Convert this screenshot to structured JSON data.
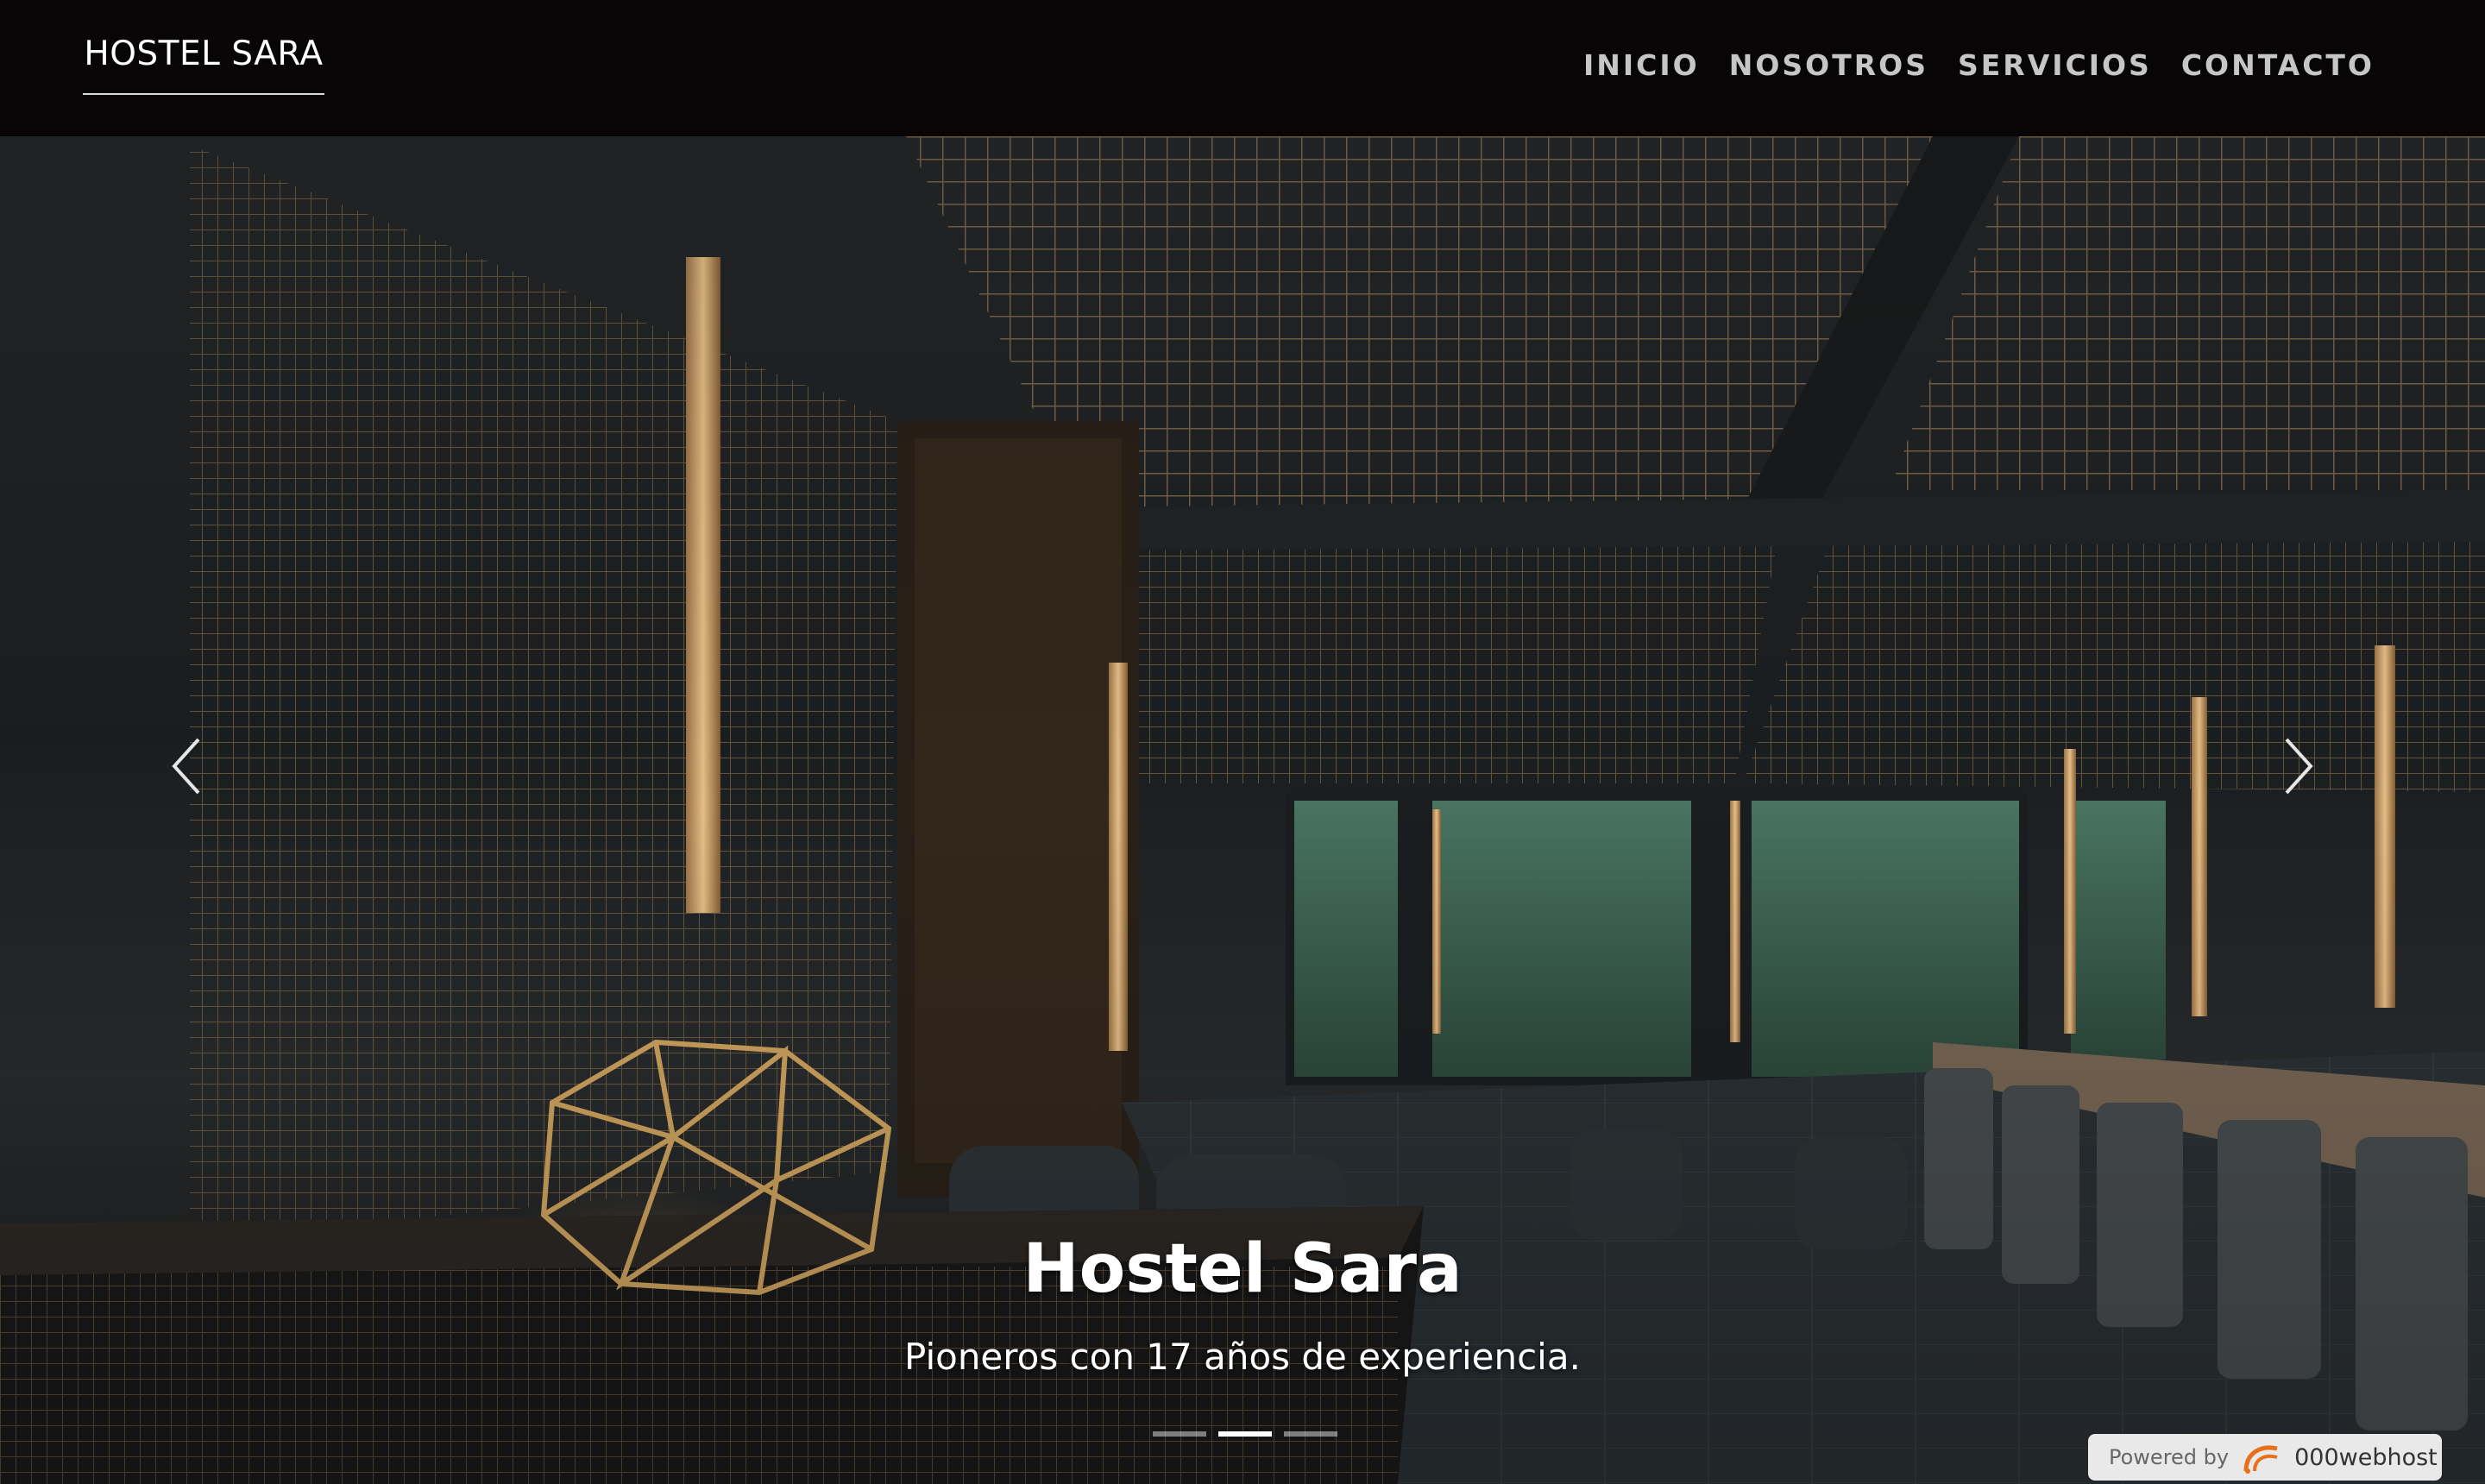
{
  "navbar": {
    "brand": "HOSTEL SARA",
    "links": [
      "INICIO",
      "NOSOTROS",
      "SERVICIOS",
      "CONTACTO"
    ]
  },
  "carousel": {
    "slide_title": "Hostel Sara",
    "slide_subtitle": "Pioneros con 17 años de experiencia.",
    "slide_count": 3,
    "active_slide_index": 1,
    "prev_icon": "chevron-left-icon",
    "next_icon": "chevron-right-icon"
  },
  "badge": {
    "prefix": "Powered by",
    "name": "000webhost",
    "icon": "000webhost-logo-icon"
  },
  "colors": {
    "navbar_bg": "#070505",
    "nav_link": "#c6c6c6",
    "accent_gold": "#c89a5a"
  }
}
